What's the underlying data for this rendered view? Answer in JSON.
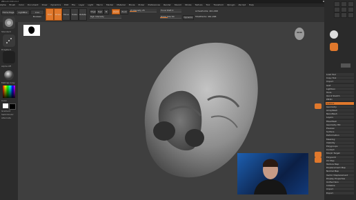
{
  "titlebar": {
    "title": "ZBrush 2021.6.2",
    "menu_status": "Menu",
    "window_controls": "– ▢ ✕"
  },
  "menubar": {
    "items": [
      "Alpha",
      "Brush",
      "Color",
      "Document",
      "Draw",
      "Dynamics",
      "Edit",
      "File",
      "Layer",
      "Light",
      "Macro",
      "Marker",
      "Material",
      "Movie",
      "Picker",
      "Preferences",
      "Render",
      "Stencil",
      "Stroke",
      "Texture",
      "Tool",
      "Transform",
      "Zplugin",
      "Zscript",
      "Help"
    ]
  },
  "toolbar": {
    "home_page": "Home Page",
    "lightbox": "LightBox",
    "live_boolean": "Live Boolean",
    "edit": "Edit",
    "draw": "Draw",
    "move": "Move",
    "scale": "Scale",
    "rotate": "Rotate",
    "mrgb": "Mrgb",
    "rgb": "Rgb",
    "m": "M",
    "zadd": "Zadd",
    "zsub": "Zsub",
    "rgb_intensity": "Rgb Intensity",
    "z_intensity": "Z Intensity 25",
    "focal_shift": "Focal Shift 0",
    "draw_size": "Draw Size 64",
    "dynamic": "Dynamic",
    "active_points": "ActivePoints: 461,068",
    "total_points": "TotalPoints: 461,068",
    "z_intensity_level": 0.25,
    "draw_size_level": 0.35
  },
  "lefttray": {
    "labels": [
      "Standard",
      "DragRect",
      "Alpha Off",
      "MatCap Gray",
      "Color",
      "Gradient",
      "SwitchColor",
      "Alternate"
    ]
  },
  "righttray": {
    "items": [
      "Load Tool",
      "Copy Tool",
      "Import",
      "GoZ",
      "Lightbox",
      "Tools",
      "Quick Sketch",
      "PM3D",
      "Subtool",
      "Geometry",
      "ArrayMesh",
      "NanoMesh",
      "Layers",
      "FiberMesh",
      "Geometry HD",
      "Preview",
      "Surface",
      "Deformation",
      "Masking",
      "Visibility",
      "Polygroups",
      "Contact",
      "Morph Target",
      "Polypaint",
      "UV Map",
      "Texture Map",
      "Displacement Map",
      "Normal Map",
      "Vector Displacement",
      "Display Properties",
      "Unified Skin",
      "Initialize",
      "Import",
      "Export"
    ]
  },
  "colors": {
    "accent": "#e0782c",
    "viewport_bg": "#3f3f3f",
    "panel_bg": "#2b2b2b"
  }
}
